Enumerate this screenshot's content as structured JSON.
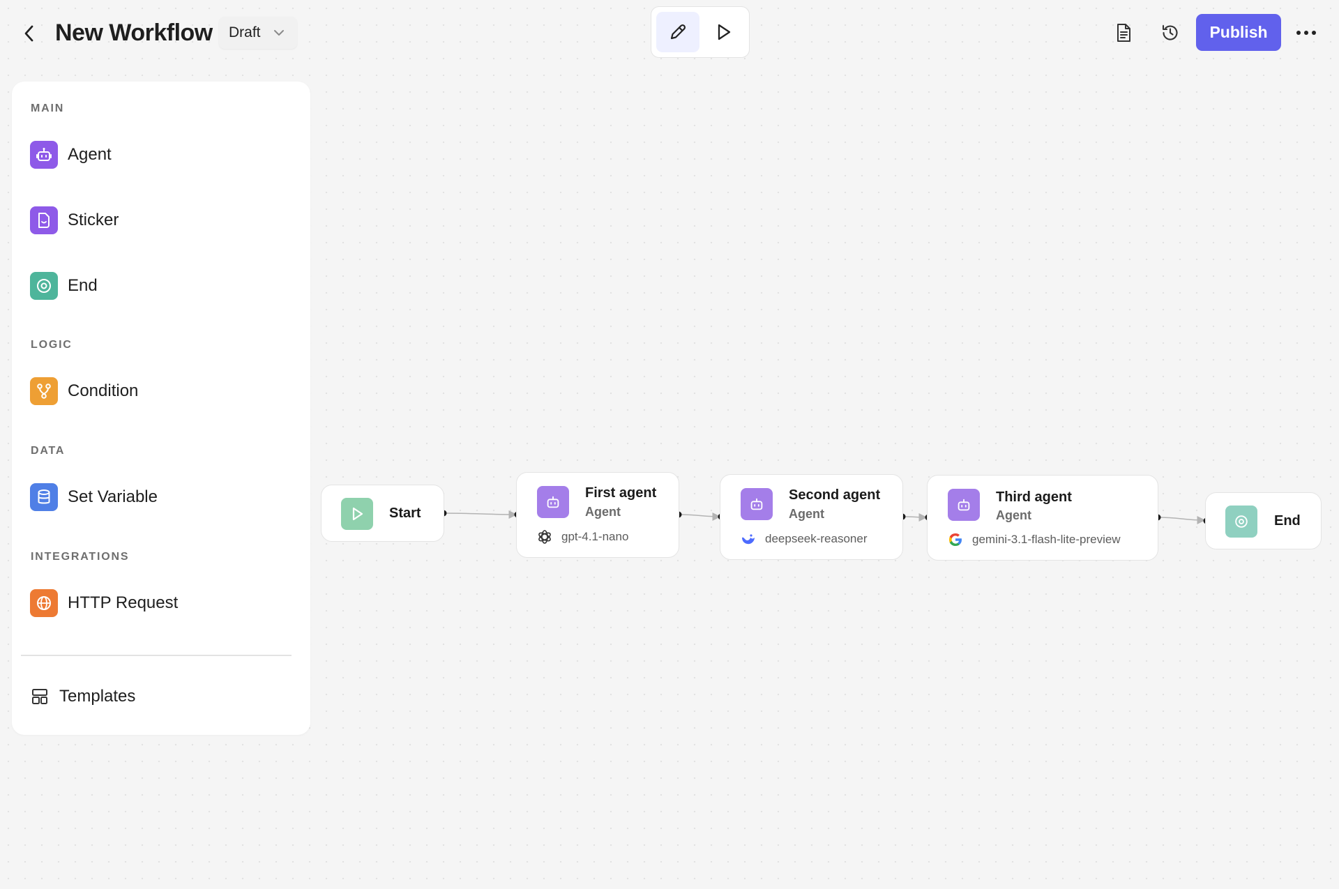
{
  "header": {
    "title": "New Workflow",
    "status_select": "Draft",
    "publish_label": "Publish"
  },
  "palette": {
    "sections": [
      {
        "label": "MAIN",
        "items": [
          "Agent",
          "Sticker",
          "End"
        ]
      },
      {
        "label": "LOGIC",
        "items": [
          "Condition"
        ]
      },
      {
        "label": "DATA",
        "items": [
          "Set Variable"
        ]
      },
      {
        "label": "INTEGRATIONS",
        "items": [
          "HTTP Request"
        ]
      }
    ],
    "templates_label": "Templates"
  },
  "colors": {
    "accent": "#6161ec",
    "agent": "#8e5ae8",
    "end": "#4eb59b",
    "condition": "#ee9f34",
    "set_variable": "#4f7fe6",
    "http_request": "#ed7a33",
    "start_node": "#8fd1ad"
  },
  "canvas": {
    "nodes": [
      {
        "id": "start",
        "title": "Start"
      },
      {
        "id": "agent1",
        "title": "First agent",
        "type": "Agent",
        "model": "gpt-4.1-nano",
        "model_icon": "openai-icon"
      },
      {
        "id": "agent2",
        "title": "Second agent",
        "type": "Agent",
        "model": "deepseek-reasoner",
        "model_icon": "deepseek-icon"
      },
      {
        "id": "agent3",
        "title": "Third agent",
        "type": "Agent",
        "model": "gemini-3.1-flash-lite-preview",
        "model_icon": "google-icon"
      },
      {
        "id": "end",
        "title": "End"
      }
    ]
  }
}
